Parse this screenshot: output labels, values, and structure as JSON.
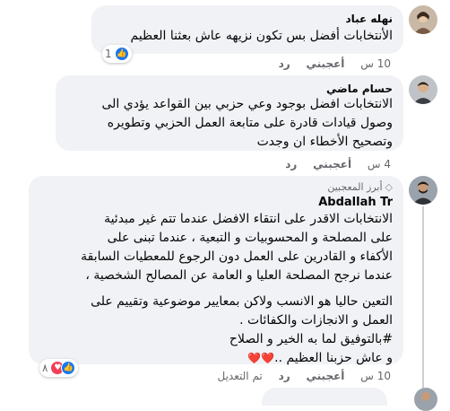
{
  "comments": [
    {
      "author": "نهله عباد",
      "text": "الأنتخابات أفضل بس تكون نزيهه عاش بعثنا العظيم",
      "time": "10 س",
      "like_label": "أعجبني",
      "reply_label": "رد",
      "reaction_count": "1"
    },
    {
      "author": "حسام ماضي",
      "text_lines": [
        "الانتخابات افضل بوجود وعي حزبي بين القواعد يؤدي الى",
        "وصول قيادات قادرة على متابعة العمل الحزبي وتطويره",
        "وتصحيح الأخطاء ان وجدت"
      ],
      "time": "4 س",
      "like_label": "أعجبني",
      "reply_label": "رد"
    },
    {
      "badge": "أبرز المعجبين",
      "author": "Abdallah Tr",
      "text_lines": [
        "الانتخابات الاقدر على انتقاء الافضل عندما تتم غير مبدئية",
        "على المصلحة و المحسوبيات و التبعية ، عندما تبنى على",
        "الأكفاء و القادرين على العمل دون الرجوع للمعطيات السابقة",
        "عندما نرجح المصلحة العليا و العامة عن المصالح الشخصية ،",
        "التعين حاليا هو الانسب ولاكن بمعايير موضوعية وتقييم على",
        "العمل و الانجازات والكفائات .",
        "#بالتوفيق لما به الخير و الصلاح",
        "و عاش حزبنا العظيم .."
      ],
      "hearts": "❤️❤️",
      "time": "10 س",
      "like_label": "أعجبني",
      "reply_label": "رد",
      "edited_label": "تم التعديل",
      "reaction_count": "٨"
    }
  ],
  "colors": {
    "bubble": "#f0f2f5",
    "meta": "#65676b",
    "like_blue": "#1877f2",
    "love_red": "#f33e58"
  }
}
